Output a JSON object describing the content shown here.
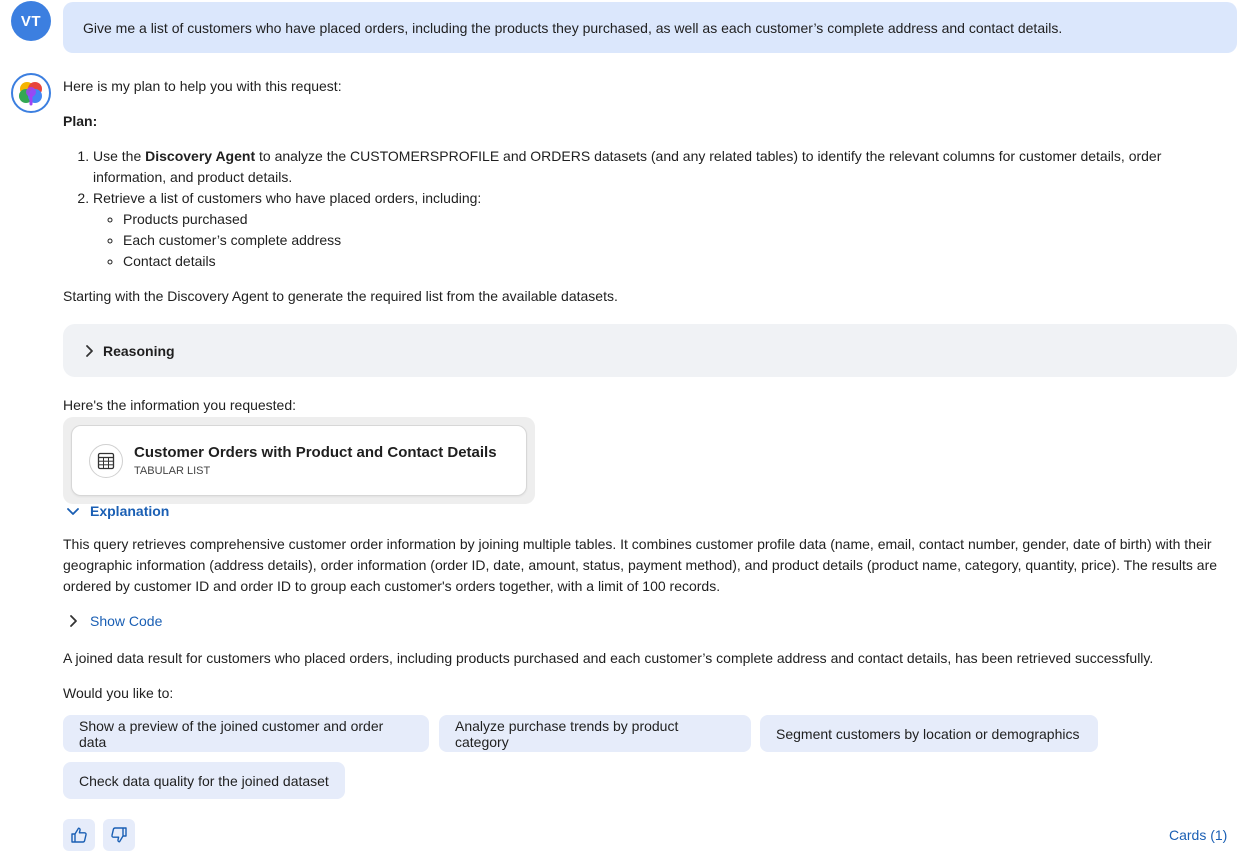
{
  "user": {
    "avatar_initials": "VT",
    "message": "Give me a list of customers who have placed orders, including the products they purchased, as well as each customer’s complete address and contact details."
  },
  "assistant": {
    "intro": "Here is my plan to help you with this request:",
    "plan_label": "Plan:",
    "steps": [
      {
        "prefix": "Use the ",
        "bold": "Discovery Agent",
        "suffix": " to analyze the CUSTOMERSPROFILE and ORDERS datasets (and any related tables) to identify the relevant columns for customer details, order information, and product details."
      },
      {
        "text": "Retrieve a list of customers who have placed orders, including:",
        "sub": [
          "Products purchased",
          "Each customer’s complete address",
          "Contact details"
        ]
      }
    ],
    "starting_text": "Starting with the Discovery Agent to generate the required list from the available datasets.",
    "reasoning_label": "Reasoning",
    "info_line": "Here's the information you requested:",
    "card": {
      "title": "Customer Orders with Product and Contact Details",
      "subtitle": "TABULAR LIST",
      "icon": "table-icon"
    },
    "explanation_label": "Explanation",
    "explanation_text": "This query retrieves comprehensive customer order information by joining multiple tables. It combines customer profile data (name, email, contact number, gender, date of birth) with their geographic information (address details), order information (order ID, date, amount, status, payment method), and product details (product name, category, quantity, price). The results are ordered by customer ID and order ID to group each customer's orders together, with a limit of 100 records.",
    "show_code_label": "Show Code",
    "result_line": "A joined data result for customers who placed orders, including products purchased and each customer’s complete address and contact details, has been retrieved successfully.",
    "would_line": "Would you like to:",
    "suggestions": [
      "Show a preview of the joined customer and order data",
      "Analyze purchase trends by product category",
      "Segment customers by location or demographics",
      "Check data quality for the joined dataset"
    ],
    "cards_link": "Cards (1)"
  },
  "colors": {
    "user_avatar": "#3c7fe0",
    "user_bubble": "#dbe7fc",
    "link": "#1a5fb4",
    "suggestion_bg": "#e6ecfa",
    "reasoning_bg": "#f0f2f5"
  }
}
